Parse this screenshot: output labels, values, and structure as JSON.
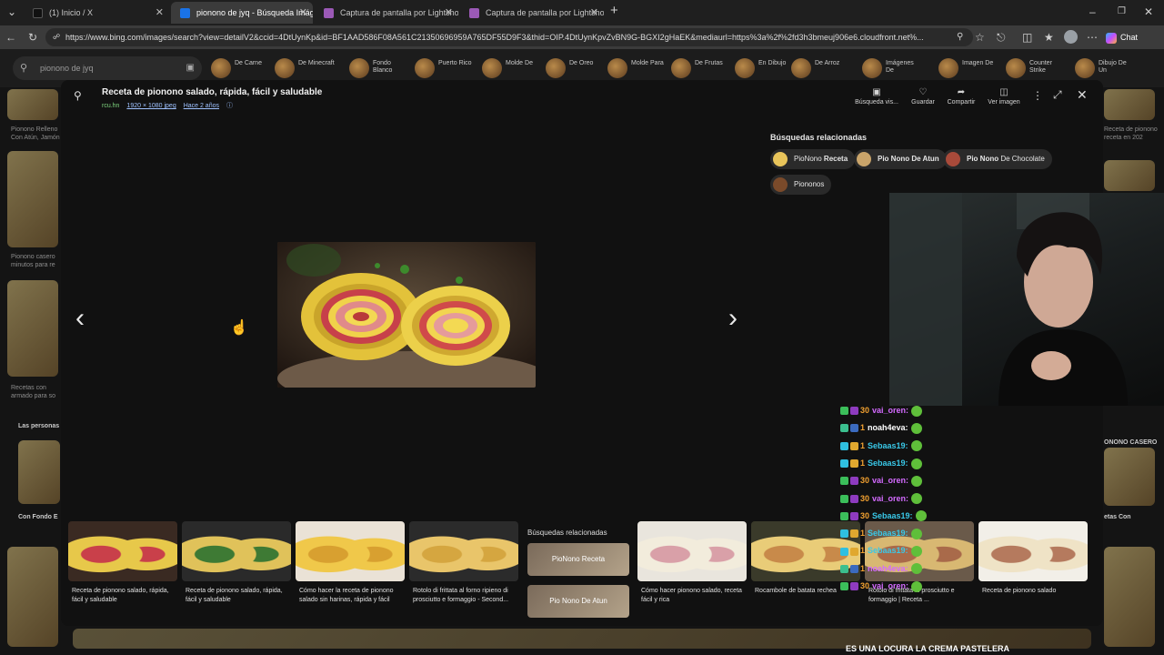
{
  "tabs": [
    {
      "label": "(1) Inicio / X",
      "fav_color": "#111111"
    },
    {
      "label": "pionono de jyq - Búsqueda Imágenes",
      "fav_color": "#1a73e8"
    },
    {
      "label": "Captura de pantalla por Lightshot",
      "fav_color": "#9b59b6"
    },
    {
      "label": "Captura de pantalla por Lightshot",
      "fav_color": "#9b59b6"
    }
  ],
  "url": "https://www.bing.com/images/search?view=detailV2&ccid=4DtUynKp&id=BF1AAD586F08A561C21350696959A765DF55D9F3&thid=OIP.4DtUynKpvZvBN9G-BGXI2gHaEK&mediaurl=https%3a%2f%2fd3h3bmeuj906e6.cloudfront.net%...",
  "chat_button": "Chat",
  "bing_search_value": "pionono de jyq",
  "bing_chips": [
    "De Carne",
    "De Minecraft",
    "Fondo Blanco",
    "Puerto Rico",
    "Molde De",
    "De Oreo",
    "Molde Para",
    "De Frutas",
    "En Dibujo",
    "De Arroz",
    "Imágenes De",
    "Imagen De",
    "Counter Strike",
    "Dibujo De Un"
  ],
  "bing_bg_texts": [
    "Pionono Relleno Con Atún, Jamón",
    "Pionono casero minutos para re",
    "Recetas con armado para so",
    "Las personas",
    "Con Fondo E"
  ],
  "bing_bg_right_texts": [
    "Receta de pionono receta en 202",
    "ONONO CASERO",
    "etas Con"
  ],
  "viewer": {
    "title": "Receta de pionono salado, rápida, fácil y saludable",
    "source": "rcu.hn",
    "dimensions": "1920 × 1080 jpeg",
    "age": "Hace 2 años",
    "actions": [
      "Búsqueda vis...",
      "Guardar",
      "Compartir",
      "Ver imagen"
    ]
  },
  "related": {
    "title": "Búsquedas relacionadas",
    "chips": [
      {
        "prefix": "PioNono ",
        "bold": "Receta"
      },
      {
        "prefix": "",
        "bold": "Pio Nono De Atun"
      },
      {
        "prefix": "",
        "bold": "Pio Nono",
        "suffix": " De Chocolate"
      },
      {
        "prefix": "Piononos",
        "bold": ""
      }
    ]
  },
  "filmstrip": [
    {
      "caption": "Receta de pionono salado, rápida, fácil y saludable"
    },
    {
      "caption": "Receta de pionono salado, rápida, fácil y saludable"
    },
    {
      "caption": "Cómo hacer la receta de pionono salado sin harinas, rápida y fácil"
    },
    {
      "caption": "Rotolo di frittata al forno ripieno di prosciutto e formaggio - Second..."
    },
    {
      "caption": "Cómo hacer pionono salado, receta fácil y rica"
    },
    {
      "caption": "Rocambole de batata rechea"
    },
    {
      "caption": "Rotolo di frittata al prosciutto e formaggio | Receta ..."
    },
    {
      "caption": "Receta de pionono salado"
    }
  ],
  "filmstrip_related": {
    "title": "Búsquedas relacionadas",
    "items": [
      "PioNono Receta",
      "Pio Nono De Atun"
    ]
  },
  "chat": [
    {
      "user": "vai_oren:",
      "color": "#d46bff",
      "badges": [
        "#3bbf5a",
        "#8e3bbf"
      ],
      "sub": "30"
    },
    {
      "user": "noah4eva:",
      "color": "#ffffff",
      "badges": [
        "#3bbf8e",
        "#3b6bbf"
      ],
      "sub": "1"
    },
    {
      "user": "Sebaas19:",
      "color": "#39c8e8",
      "badges": [
        "#2fbfe0",
        "#e0a82f"
      ],
      "sub": "1"
    },
    {
      "user": "Sebaas19:",
      "color": "#39c8e8",
      "badges": [
        "#2fbfe0",
        "#e0a82f"
      ],
      "sub": "1"
    },
    {
      "user": "vai_oren:",
      "color": "#d46bff",
      "badges": [
        "#3bbf5a",
        "#8e3bbf"
      ],
      "sub": "30"
    },
    {
      "user": "vai_oren:",
      "color": "#d46bff",
      "badges": [
        "#3bbf5a",
        "#8e3bbf"
      ],
      "sub": "30"
    },
    {
      "user": "Sebaas19:",
      "color": "#39c8e8",
      "badges": [
        "#3bbf5a",
        "#8e3bbf"
      ],
      "sub": "30"
    },
    {
      "user": "Sebaas19:",
      "color": "#39c8e8",
      "badges": [
        "#2fbfe0",
        "#e0a82f"
      ],
      "sub": "1"
    },
    {
      "user": "Sebaas19:",
      "color": "#39c8e8",
      "badges": [
        "#2fbfe0",
        "#e0a82f"
      ],
      "sub": "1"
    },
    {
      "user": "noah4eva:",
      "color": "#d46bff",
      "badges": [
        "#3bbf8e",
        "#3b6bbf"
      ],
      "sub": "1"
    },
    {
      "user": "vai_oren:",
      "color": "#d46bff",
      "badges": [
        "#3bbf5a",
        "#8e3bbf"
      ],
      "sub": "30"
    }
  ],
  "ticker": "ES UNA LOCURA LA CREMA PASTELERA"
}
